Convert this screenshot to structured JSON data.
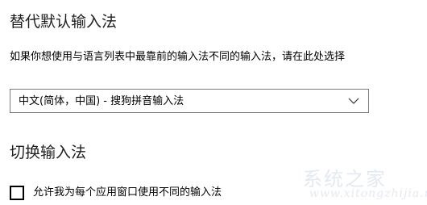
{
  "override_section": {
    "title": "替代默认输入法",
    "description": "如果你想使用与语言列表中最靠前的输入法不同的输入法，请在此处选择",
    "dropdown": {
      "selected_value": "中文(简体，中国) - 搜狗拼音输入法",
      "icon": "chevron-down-icon"
    }
  },
  "switch_section": {
    "title": "切换输入法",
    "checkbox": {
      "label": "允许我为每个应用窗口使用不同的输入法",
      "checked": false
    }
  },
  "watermark": {
    "glyphs": "系统之家",
    "text": "www.xitongzhijia.net"
  }
}
